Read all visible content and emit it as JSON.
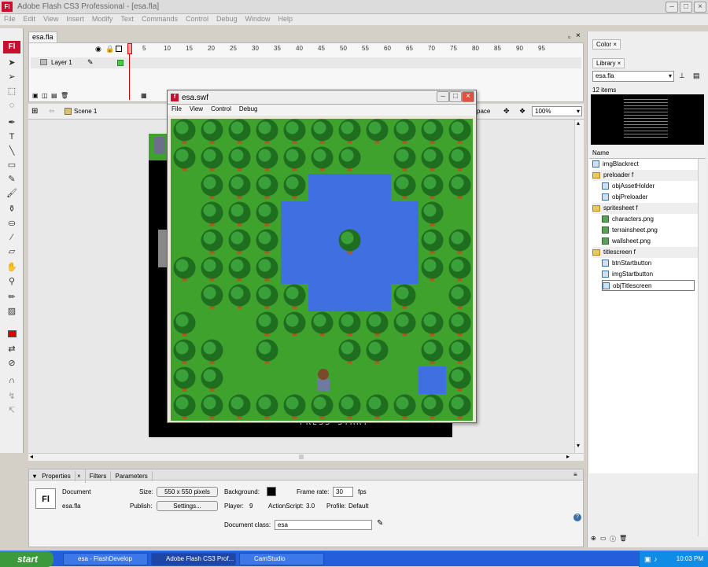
{
  "window": {
    "title": "Adobe Flash CS3 Professional - [esa.fla]",
    "logo": "Fl"
  },
  "menu": [
    "File",
    "Edit",
    "View",
    "Insert",
    "Modify",
    "Text",
    "Commands",
    "Control",
    "Debug",
    "Window",
    "Help"
  ],
  "document_tab": "esa.fla",
  "timeline": {
    "frame_numbers": [
      "5",
      "10",
      "15",
      "20",
      "25",
      "30",
      "35",
      "40",
      "45",
      "50",
      "55",
      "60",
      "65",
      "70",
      "75",
      "80",
      "85",
      "90",
      "95"
    ],
    "layer_name": "Layer 1"
  },
  "editbar": {
    "scene": "Scene 1",
    "workspace_partial": "pace",
    "zoom": "100%"
  },
  "swf_window": {
    "title": "esa.swf",
    "menu": [
      "File",
      "View",
      "Control",
      "Debug"
    ]
  },
  "stage_text": "PRESS START",
  "properties": {
    "tabs": [
      "Properties",
      "Filters",
      "Parameters"
    ],
    "doc_type": "Document",
    "doc_name": "esa.fla",
    "size_label": "Size:",
    "size_value": "550 x 550 pixels",
    "background_label": "Background:",
    "background_color": "#000000",
    "frame_rate_label": "Frame rate:",
    "frame_rate": "30",
    "fps": "fps",
    "publish_label": "Publish:",
    "settings_button": "Settings...",
    "player_label": "Player:",
    "player_value": "9",
    "actionscript_label": "ActionScript:",
    "actionscript_value": "3.0",
    "profile_label": "Profile:",
    "profile_value": "Default",
    "doc_class_label": "Document class:",
    "doc_class_value": "esa"
  },
  "color_panel": {
    "tab": "Color"
  },
  "library": {
    "tab": "Library",
    "file_select": "esa.fla",
    "item_count": "12 items",
    "column_name": "Name",
    "items": [
      {
        "label": "imgBlackrect",
        "kind": "symbol",
        "indent": 0
      },
      {
        "label": "preloader f",
        "kind": "folder",
        "indent": 0
      },
      {
        "label": "objAssetHolder",
        "kind": "symbol",
        "indent": 1
      },
      {
        "label": "objPreloader",
        "kind": "symbol",
        "indent": 1
      },
      {
        "label": "spritesheet f",
        "kind": "folder",
        "indent": 0
      },
      {
        "label": "characters.png",
        "kind": "bitmap",
        "indent": 1
      },
      {
        "label": "terrainsheet.png",
        "kind": "bitmap",
        "indent": 1
      },
      {
        "label": "wallsheet.png",
        "kind": "bitmap",
        "indent": 1
      },
      {
        "label": "titlescreen f",
        "kind": "folder",
        "indent": 0
      },
      {
        "label": "btnStartbutton",
        "kind": "symbol",
        "indent": 1
      },
      {
        "label": "imgStartbutton",
        "kind": "symbol",
        "indent": 1
      },
      {
        "label": "objTitlescreen",
        "kind": "symbol",
        "indent": 1
      }
    ]
  },
  "taskbar": {
    "start": "start",
    "tasks": [
      "esa - FlashDevelop",
      "Adobe Flash CS3 Prof...",
      "CamStudio"
    ],
    "clock": "10:03 PM"
  },
  "colors": {
    "grass": "#3ea22c",
    "water": "#3f6fe0",
    "tree_dark": "#1f6e1f",
    "tree_light": "#3aa03a",
    "trunk": "#b5561e",
    "accent_red": "#c8102e"
  }
}
